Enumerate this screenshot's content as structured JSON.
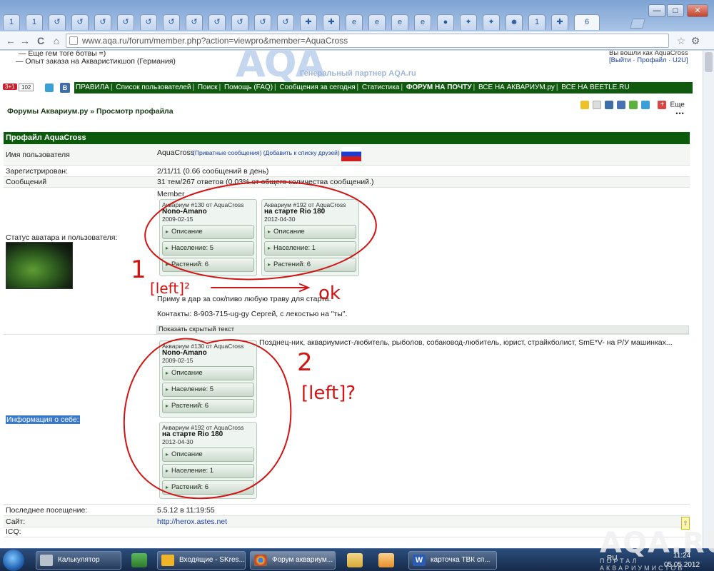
{
  "browser": {
    "url": "www.aqa.ru/forum/member.php?action=viewpro&member=AquaCross",
    "active_tab_label": "6",
    "tabs": [
      "1",
      "1",
      "↺",
      "↺",
      "↺",
      "↺",
      "↺",
      "↺",
      "↺",
      "↺",
      "↺",
      "↺",
      "↺",
      "✚",
      "✚",
      "e",
      "e",
      "e",
      "e",
      "●",
      "✦",
      "✦",
      "☻",
      "1",
      "✚"
    ],
    "nav": {
      "back": "←",
      "forward": "→",
      "reload": "C",
      "home": "⌂",
      "star": "☆",
      "wrench": "⚙"
    },
    "window_buttons": {
      "minimize": "—",
      "maximize": "□",
      "close": "✕"
    }
  },
  "page": {
    "top_links": [
      "— Еще гем тоге ботвы =)",
      "— Опыт заказа на Акваристикшоп (Германия)"
    ],
    "logo_text": "AQA",
    "partner_text": "Генеральный партнер AQA.ru",
    "user_box": [
      "Вы вошли как AquaCross",
      "[Выйти · Профайл · U2U]"
    ],
    "counters": [
      "3+1",
      "102"
    ],
    "counter_icons": [
      "twitter",
      "vk"
    ],
    "navbar": [
      "ПРАВИЛА",
      "Список пользователей",
      "Поиск",
      "Помощь (FAQ)",
      "Сообщения за сегодня",
      "Статистика",
      "ФОРУМ НА ПОЧТУ",
      "ВСЕ НА АКВАРИУМ.ру",
      "ВСЕ НА BEETLE.RU"
    ],
    "breadcrumb": "Форумы Аквариум.ру » Просмотр профайла",
    "share_more": "Еще",
    "profile_header": "Профайл AquaCross",
    "rows": {
      "username_label": "Имя пользователя",
      "username_value": "AquaCross",
      "username_links": "(Приватные сообщения) (Добавить к списку друзей)",
      "registered_label": "Зарегистрирован:",
      "registered_value": "2/11/11 (0.66 сообщений в день)",
      "posts_label": "Сообщений",
      "posts_value": "31 тем/267 ответов (0.03% от общего количества сообщений.)",
      "status_label": "Статус аватара и пользователя:",
      "status_value": "Member",
      "signature_1": "Приму в дар за сок/пиво любую траву для старта.",
      "signature_2": "Контакты: 8-903-715-ug-gy Сергей, с лекостью на \"ты\".",
      "hidden_text": "Показать скрытый текст",
      "about_label": "Информация о себе:",
      "about_value": "Позднец-ник, аквариумист-любитель, рыболов, собаковод-любитель, юрист, страйкболист, SmE*V- на Р/У машинках...",
      "last_visit_label": "Последнее посещение:",
      "last_visit_value": "5.5.12 в 11:19:55",
      "site_label": "Сайт:",
      "site_value": "http://herox.astes.net",
      "icq_label": "ICQ:"
    },
    "aquariums_top": [
      {
        "caption": "Аквариум #130 от AquaCross",
        "name": "Nono-Amano",
        "date": "2009-02-15",
        "buttons": [
          "Описание",
          "Население: 5",
          "Растений: 6"
        ]
      },
      {
        "caption": "Аквариум #192 от AquaCross",
        "name": "на старте Rio 180",
        "date": "2012-04-30",
        "buttons": [
          "Описание",
          "Население: 1",
          "Растений: 6"
        ]
      }
    ],
    "aquariums_bottom": [
      {
        "caption": "Аквариум #130 от AquaCross",
        "name": "Nono-Amano",
        "date": "2009-02-15",
        "buttons": [
          "Описание",
          "Население: 5",
          "Растений: 6"
        ]
      },
      {
        "caption": "Аквариум #192 от AquaCross",
        "name": "на старте Rio 180",
        "date": "2012-04-30",
        "buttons": [
          "Описание",
          "Население: 1",
          "Растений: 6"
        ]
      }
    ],
    "annotations": {
      "num1": "1",
      "num2": "2",
      "left1": "[left]²",
      "ok": "ok",
      "left2": "[left]?"
    }
  },
  "taskbar": {
    "tasks": [
      "Калькулятор",
      "Входящие - SKres...",
      "Форум аквариум...",
      "карточка ТВК сп..."
    ],
    "lang": "RU",
    "time": "11:24",
    "date": "05.05.2012",
    "watermark": "AQA.RU",
    "watermark_sub": "ПОРТАЛ АКВАРИУМИСТОВ"
  },
  "colors": {
    "forum_green": "#0c5b0c",
    "annotation_red": "#d11414",
    "link_blue": "#1a3fa8"
  }
}
